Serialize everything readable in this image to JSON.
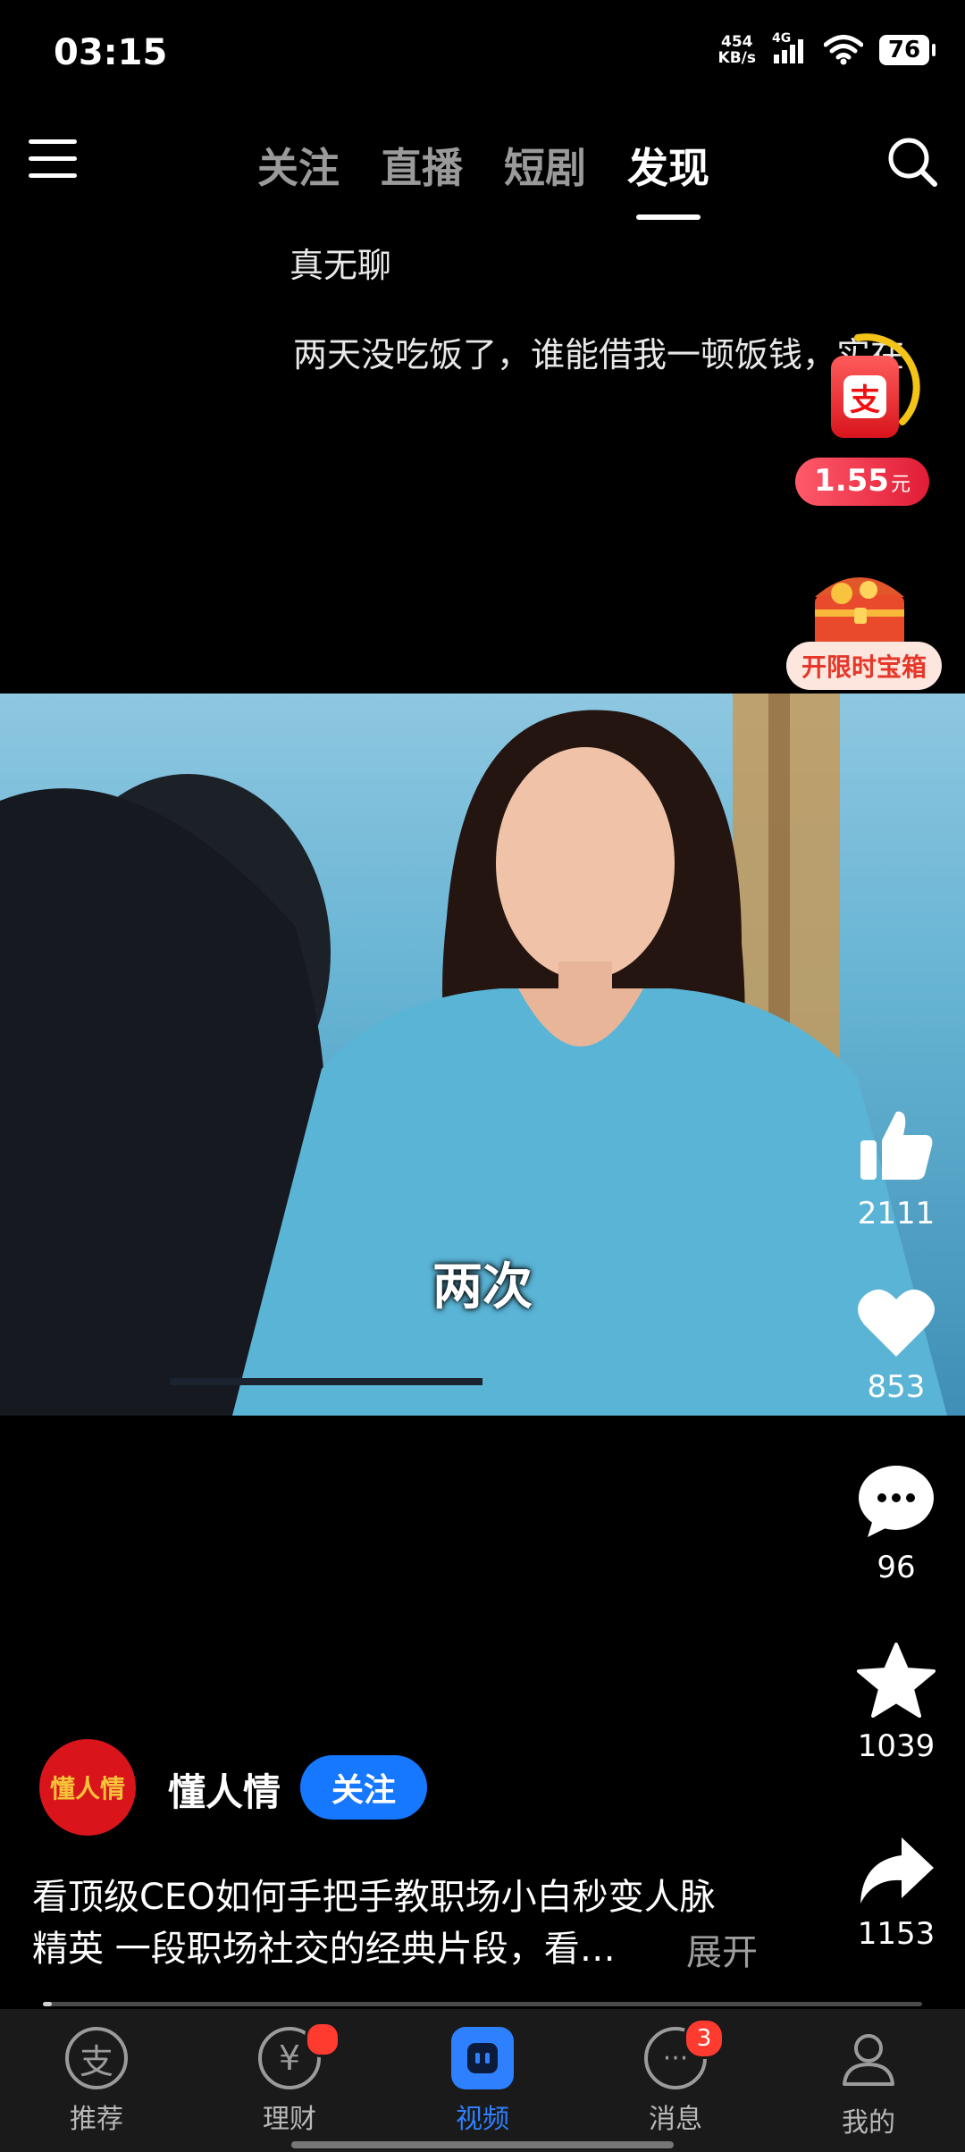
{
  "status_bar": {
    "time": "03:15",
    "net_speed_value": "454",
    "net_speed_unit": "KB/s",
    "network_type": "4G",
    "battery": "76"
  },
  "top_nav": {
    "tabs": [
      {
        "label": "关注",
        "active": false
      },
      {
        "label": "直播",
        "active": false
      },
      {
        "label": "短剧",
        "active": false
      },
      {
        "label": "发现",
        "active": true
      }
    ]
  },
  "danmaku": [
    {
      "text": "真无聊"
    },
    {
      "text": "两天没吃饭了，谁能借我一顿饭钱，实在"
    }
  ],
  "reward": {
    "amount": "1.55",
    "unit": "元",
    "icon": "alipay-red-envelope-icon",
    "treasure_label": "开限时宝箱",
    "treasure_icon": "treasure-chest-icon"
  },
  "video": {
    "subtitle": "两次"
  },
  "actions": {
    "like_count": "2111",
    "favorite_count": "853",
    "comment_count": "96",
    "star_count": "1039",
    "share_count": "1153"
  },
  "author": {
    "avatar_text": "懂人情",
    "name": "懂人情",
    "follow_label": "关注"
  },
  "description": {
    "line1": "看顶级CEO如何手把手教职场小白秒变人脉",
    "line2": "精英 一段职场社交的经典片段，看…",
    "expand_label": "展开"
  },
  "progress": {
    "fraction": 0.01
  },
  "bottom_nav": {
    "items": [
      {
        "label": "推荐",
        "icon": "alipay-icon",
        "active": false
      },
      {
        "label": "理财",
        "icon": "yuan-icon",
        "active": false,
        "dot": true
      },
      {
        "label": "视频",
        "icon": "video-icon",
        "active": true
      },
      {
        "label": "消息",
        "icon": "message-icon",
        "active": false,
        "badge": "3"
      },
      {
        "label": "我的",
        "icon": "profile-icon",
        "active": false
      }
    ]
  },
  "colors": {
    "accent_blue": "#1677ff",
    "badge_red": "#ff3b30",
    "avatar_red": "#d9151b"
  }
}
